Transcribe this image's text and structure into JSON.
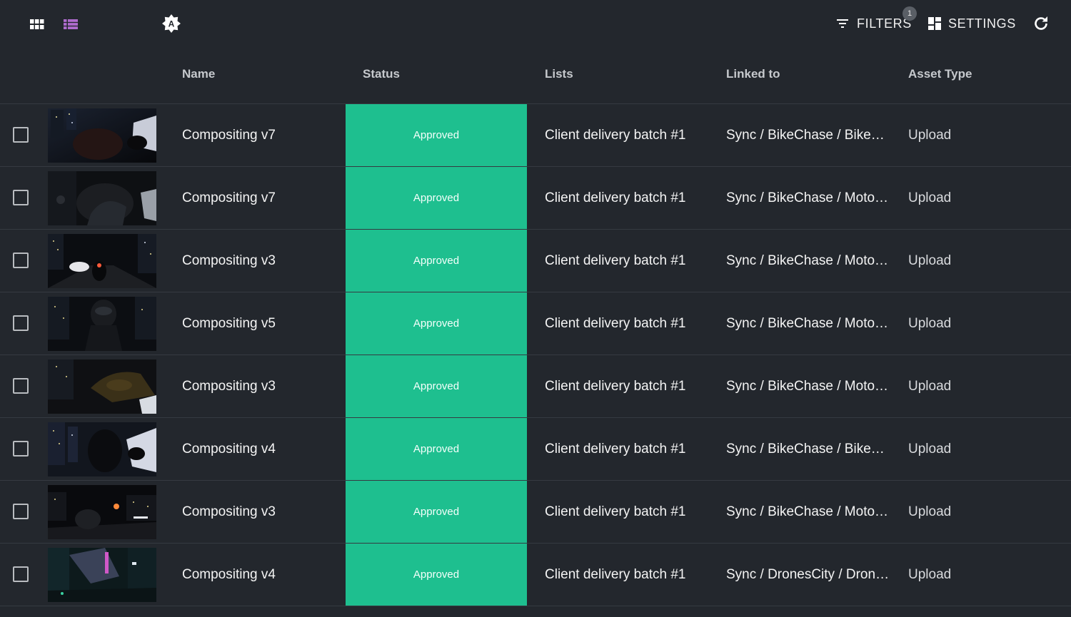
{
  "toolbar": {
    "filters_label": "FILTERS",
    "filters_count": "1",
    "settings_label": "SETTINGS",
    "auto_icon_letter": "A"
  },
  "columns": {
    "name": "Name",
    "status": "Status",
    "lists": "Lists",
    "linked": "Linked to",
    "type": "Asset Type"
  },
  "colors": {
    "background": "#23272d",
    "status_approved": "#1ebf8f",
    "list_view_active": "#b06ccf"
  },
  "rows": [
    {
      "name": "Compositing v7",
      "status": "Approved",
      "list": "Client delivery batch #1",
      "linked": "Sync / BikeChase / Bike…",
      "type": "Upload"
    },
    {
      "name": "Compositing v7",
      "status": "Approved",
      "list": "Client delivery batch #1",
      "linked": "Sync / BikeChase / Moto…",
      "type": "Upload"
    },
    {
      "name": "Compositing v3",
      "status": "Approved",
      "list": "Client delivery batch #1",
      "linked": "Sync / BikeChase / Moto…",
      "type": "Upload"
    },
    {
      "name": "Compositing v5",
      "status": "Approved",
      "list": "Client delivery batch #1",
      "linked": "Sync / BikeChase / Moto…",
      "type": "Upload"
    },
    {
      "name": "Compositing v3",
      "status": "Approved",
      "list": "Client delivery batch #1",
      "linked": "Sync / BikeChase / Moto…",
      "type": "Upload"
    },
    {
      "name": "Compositing v4",
      "status": "Approved",
      "list": "Client delivery batch #1",
      "linked": "Sync / BikeChase / Bike…",
      "type": "Upload"
    },
    {
      "name": "Compositing v3",
      "status": "Approved",
      "list": "Client delivery batch #1",
      "linked": "Sync / BikeChase / Moto…",
      "type": "Upload"
    },
    {
      "name": "Compositing v4",
      "status": "Approved",
      "list": "Client delivery batch #1",
      "linked": "Sync / DronesCity / Dron…",
      "type": "Upload"
    }
  ]
}
